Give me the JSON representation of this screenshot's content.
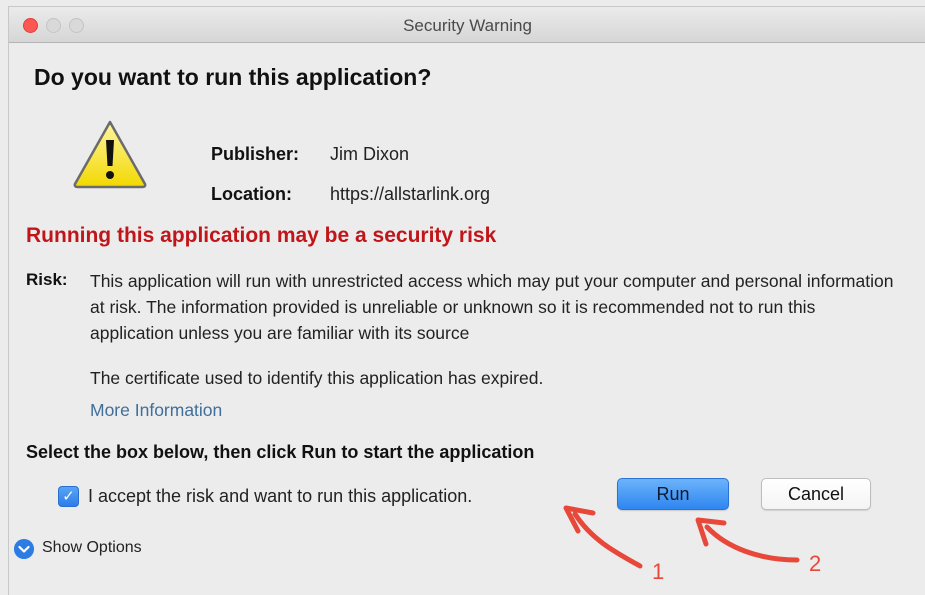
{
  "window": {
    "title": "Security Warning"
  },
  "dialog": {
    "heading": "Do you want to run this application?",
    "publisher_label": "Publisher:",
    "publisher_value": "Jim Dixon",
    "location_label": "Location:",
    "location_value": "https://allstarlink.org",
    "risk_title": "Running this application may be a security risk",
    "risk_label": "Risk:",
    "risk_text": "This application will run with unrestricted access which may put your computer and personal information at risk. The information provided is unreliable or unknown so it is recommended not to run this application unless you are familiar with its source",
    "certificate_text": "The certificate used to identify this application has expired.",
    "more_info_link": "More Information",
    "instruction": "Select the box below, then click Run to start the application",
    "accept_checkbox_label": "I accept the risk and want to run this application.",
    "accept_checked": true,
    "run_button": "Run",
    "cancel_button": "Cancel",
    "show_options": "Show Options"
  },
  "annotations": {
    "step1": "1",
    "step2": "2"
  },
  "icons": {
    "warning": "warning-triangle-icon",
    "checkbox": "checkmark-icon",
    "disclosure": "chevron-down-icon"
  },
  "colors": {
    "risk_red": "#c0161a",
    "link_blue": "#3f6f9a",
    "accent_blue": "#2f86f0",
    "annotation_red": "#e8483a"
  }
}
